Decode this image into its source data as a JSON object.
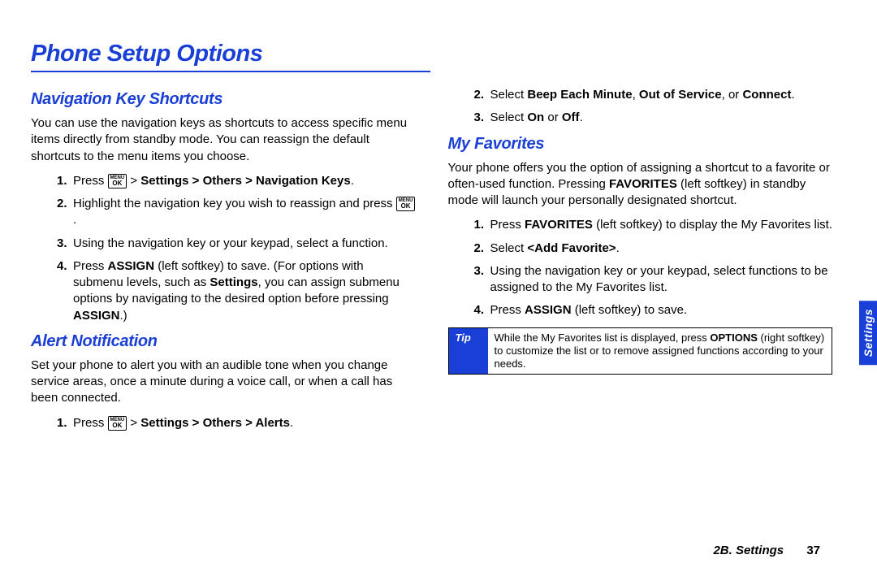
{
  "title": "Phone Setup Options",
  "side_tab": "Settings",
  "footer": {
    "section": "2B. Settings",
    "page": "37"
  },
  "menu_ok": {
    "top": "MENU",
    "bottom": "OK"
  },
  "left": {
    "nav": {
      "heading": "Navigation Key Shortcuts",
      "blurb": "You can use the navigation keys as shortcuts to access specific menu items directly from standby mode. You can reassign the default shortcuts to the menu items you choose.",
      "steps": {
        "s1_pre": "Press ",
        "s1_post_a": " > ",
        "s1_path": "Settings > Others > Navigation Keys",
        "s1_end": ".",
        "s2_a": "Highlight the navigation key you wish to reassign and press ",
        "s2_end": ".",
        "s3": "Using the navigation key or your keypad, select a function.",
        "s4_a": "Press ",
        "s4_b": "ASSIGN",
        "s4_c": " (left softkey) to save. (For options with submenu levels, such as ",
        "s4_d": "Settings",
        "s4_e": ", you can assign submenu options by navigating to the desired option before pressing ",
        "s4_f": "ASSIGN",
        "s4_g": ".)"
      }
    },
    "alert": {
      "heading": "Alert Notification",
      "blurb": "Set your phone to alert you with an audible tone when you change service areas, once a minute during a voice call, or when a call has been connected.",
      "s1_pre": "Press ",
      "s1_path": "Settings > Others > Alerts",
      "s1_end": "."
    }
  },
  "right": {
    "top": {
      "s2_a": "Select ",
      "s2_b": "Beep Each Minute",
      "s2_c": ", ",
      "s2_d": "Out of Service",
      "s2_e": ", or ",
      "s2_f": "Connect",
      "s2_g": ".",
      "s3_a": "Select ",
      "s3_b": "On",
      "s3_c": " or ",
      "s3_d": "Off",
      "s3_e": "."
    },
    "fav": {
      "heading": "My Favorites",
      "blurb_a": "Your phone offers you the option of assigning a shortcut to a favorite or often-used function. Pressing ",
      "blurb_b": "FAVORITES",
      "blurb_c": " (left softkey) in standby mode will launch your personally designated shortcut.",
      "s1_a": "Press ",
      "s1_b": "FAVORITES",
      "s1_c": " (left softkey) to display the My Favorites list.",
      "s2_a": "Select ",
      "s2_b": "<Add Favorite>",
      "s2_c": ".",
      "s3": "Using the navigation key or your keypad, select functions to be assigned to the My Favorites list.",
      "s4_a": "Press ",
      "s4_b": "ASSIGN",
      "s4_c": " (left softkey) to save."
    },
    "tip": {
      "label": "Tip",
      "t_a": "While the My Favorites list is displayed, press ",
      "t_b": "OPTIONS",
      "t_c": " (right softkey) to customize the list or to remove assigned functions according to your needs."
    }
  }
}
